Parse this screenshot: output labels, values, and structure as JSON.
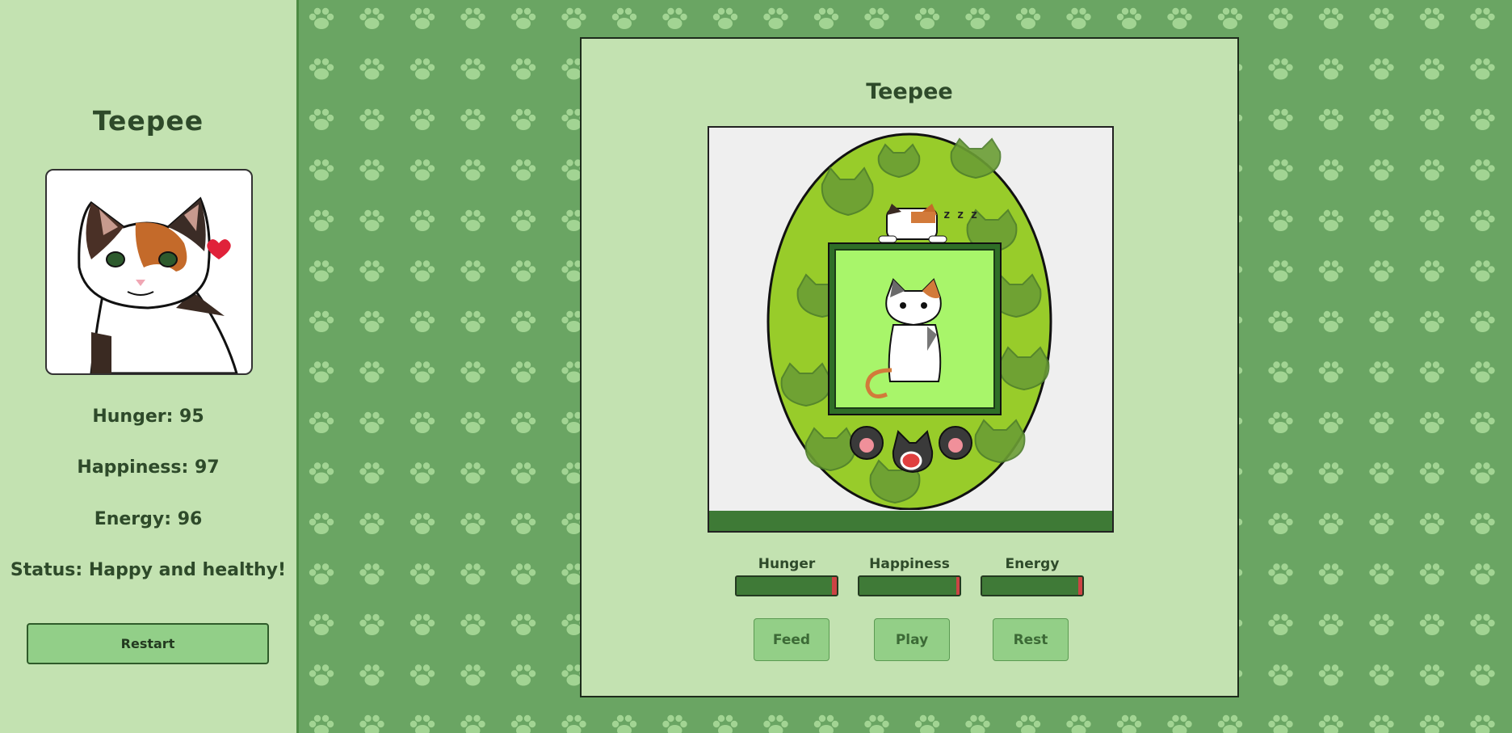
{
  "sidebar": {
    "pet_name": "Teepee",
    "stats": {
      "hunger": "Hunger: 95",
      "happiness": "Happiness: 97",
      "energy": "Energy: 96",
      "status": "Status: Happy and healthy!"
    },
    "restart_label": "Restart"
  },
  "main": {
    "pet_name": "Teepee",
    "bars": [
      {
        "label": "Hunger",
        "value": 0.95
      },
      {
        "label": "Happiness",
        "value": 0.97
      },
      {
        "label": "Energy",
        "value": 0.96
      }
    ],
    "actions": {
      "feed": "Feed",
      "play": "Play",
      "rest": "Rest"
    }
  },
  "colors": {
    "sidebar_bg": "#c3e2b1",
    "pattern_bg": "#6aa563",
    "paw_color": "#a2d493",
    "bar_fill": "#3f7a37",
    "bar_empty": "#cc4444",
    "button_bg": "#93cf87"
  },
  "icons": [
    "paw-icon",
    "heart-icon",
    "sleep-zzz-icon"
  ]
}
